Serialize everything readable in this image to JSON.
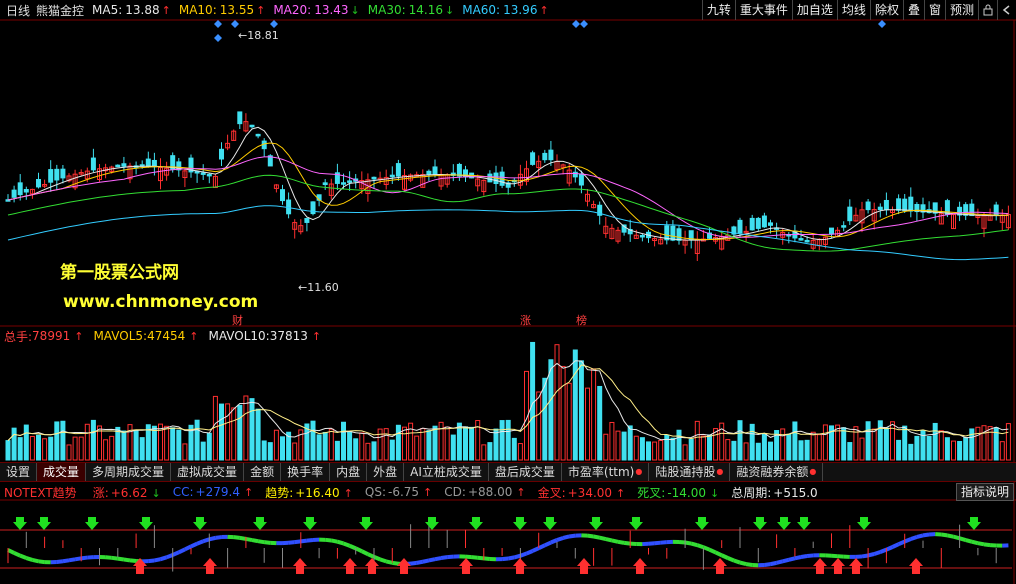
{
  "header": {
    "period": "日线",
    "stock_name": "熊猫金控",
    "ma": [
      {
        "label": "MA5:",
        "value": "13.88",
        "color": "#e8e8e8",
        "dir": "up"
      },
      {
        "label": "MA10:",
        "value": "13.55",
        "color": "#ffcc00",
        "dir": "up"
      },
      {
        "label": "MA20:",
        "value": "13.43",
        "color": "#ff66ff",
        "dir": "down"
      },
      {
        "label": "MA30:",
        "value": "14.16",
        "color": "#33dd33",
        "dir": "down"
      },
      {
        "label": "MA60:",
        "value": "13.96",
        "color": "#33ccff",
        "dir": "up"
      }
    ],
    "arrows": {
      "up": "↑",
      "down": "↓"
    }
  },
  "toolbar": {
    "buttons": [
      "九转",
      "重大事件",
      "加自选",
      "均线",
      "除权",
      "叠",
      "窗",
      "预测"
    ],
    "lock_icon": "lock-icon",
    "back_icon": "back-icon"
  },
  "price_chart": {
    "high_label": "18.81",
    "low_label": "11.60",
    "events": [
      "财",
      "涨",
      "榜"
    ]
  },
  "watermark": {
    "line1": "第一股票公式网",
    "line2": "www.chnmoney.com"
  },
  "volume": {
    "total_label": "总手:",
    "total_value": "78991",
    "mavol5_label": "MAVOL5:",
    "mavol5_value": "47454",
    "mavol10_label": "MAVOL10:",
    "mavol10_value": "37813"
  },
  "tabs": [
    {
      "label": "设置",
      "dot": false
    },
    {
      "label": "成交量",
      "dot": false,
      "active": true
    },
    {
      "label": "多周期成交量",
      "dot": false
    },
    {
      "label": "虚拟成交量",
      "dot": false
    },
    {
      "label": "金额",
      "dot": false
    },
    {
      "label": "换手率",
      "dot": false
    },
    {
      "label": "内盘",
      "dot": false
    },
    {
      "label": "外盘",
      "dot": false
    },
    {
      "label": "AI立桩成交量",
      "dot": false
    },
    {
      "label": "盘后成交量",
      "dot": false
    },
    {
      "label": "市盈率(ttm)",
      "dot": true
    },
    {
      "label": "陆股通持股",
      "dot": true
    },
    {
      "label": "融资融券余额",
      "dot": true
    }
  ],
  "indicator": {
    "name": "NOTEXT趋势",
    "items": [
      {
        "label": "涨:",
        "value": "+6.62",
        "color": "#ff3030",
        "dir": "down"
      },
      {
        "label": "CC:",
        "value": "+279.4",
        "color": "#3060ff",
        "dir": "up"
      },
      {
        "label": "趋势:",
        "value": "+16.40",
        "color": "#ffee00",
        "dir": "up"
      },
      {
        "label": "QS:",
        "value": "-6.75",
        "color": "#999999",
        "dir": "up"
      },
      {
        "label": "CD:",
        "value": "+88.00",
        "color": "#999999",
        "dir": "up"
      },
      {
        "label": "金叉:",
        "value": "+34.00",
        "color": "#ff3030",
        "dir": "up"
      },
      {
        "label": "死叉:",
        "value": "-14.00",
        "color": "#33dd33",
        "dir": "down"
      },
      {
        "label": "总周期:",
        "value": "+515.0",
        "color": "#e8e8e8",
        "dir": "none"
      }
    ],
    "button": "指标说明"
  }
}
